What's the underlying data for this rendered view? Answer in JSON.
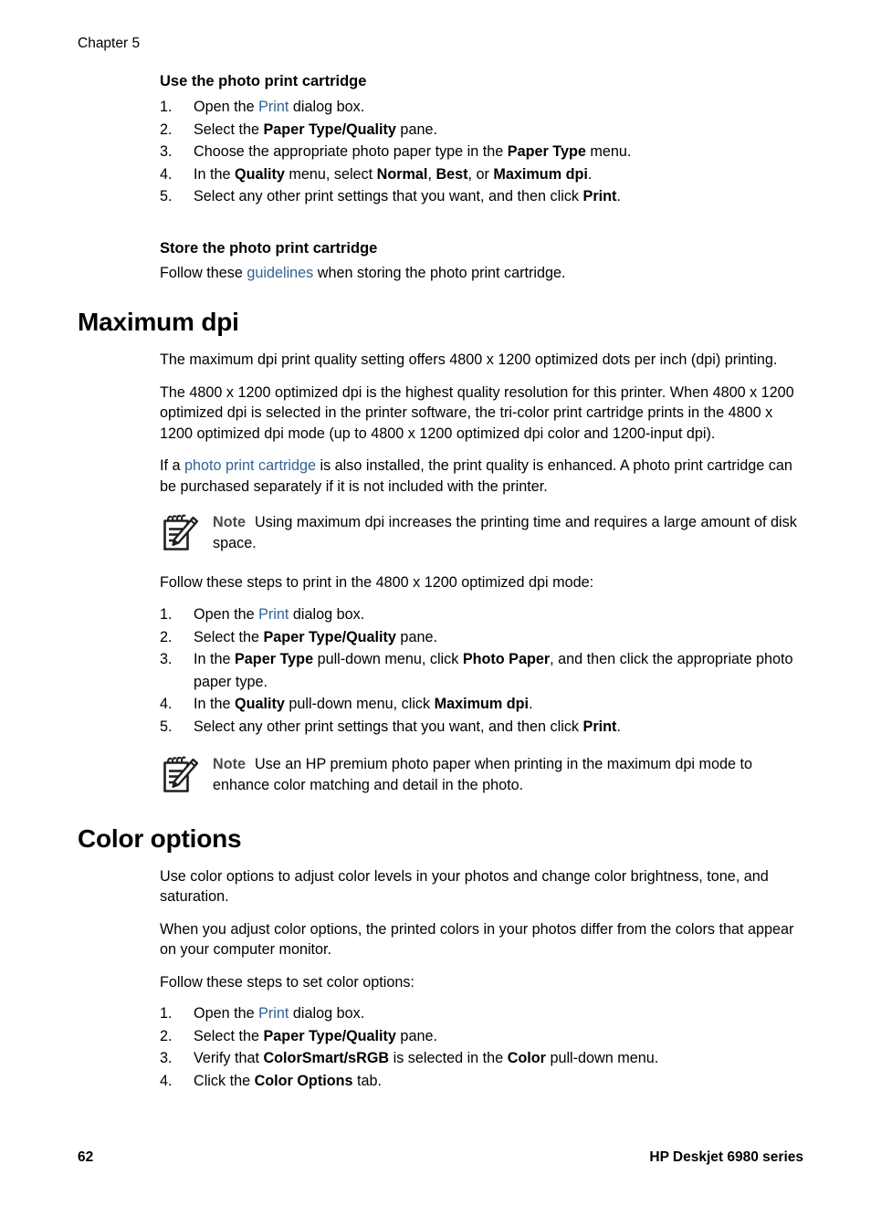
{
  "page": {
    "chapter_header": "Chapter 5",
    "footer_page_number": "62",
    "footer_product": "HP Deskjet 6980 series",
    "link_color": "#2f6196",
    "note_label_color": "#4a4a4a"
  },
  "sections": {
    "use_photo_cartridge": {
      "heading": "Use the photo print cartridge",
      "steps": [
        {
          "num": "1.",
          "parts": [
            {
              "t": "Open the ",
              "style": "normal"
            },
            {
              "t": "Print",
              "style": "link"
            },
            {
              "t": " dialog box.",
              "style": "normal"
            }
          ]
        },
        {
          "num": "2.",
          "parts": [
            {
              "t": "Select the ",
              "style": "normal"
            },
            {
              "t": "Paper Type/Quality",
              "style": "bold"
            },
            {
              "t": " pane.",
              "style": "normal"
            }
          ]
        },
        {
          "num": "3.",
          "parts": [
            {
              "t": "Choose the appropriate photo paper type in the ",
              "style": "normal"
            },
            {
              "t": "Paper Type",
              "style": "bold"
            },
            {
              "t": " menu.",
              "style": "normal"
            }
          ]
        },
        {
          "num": "4.",
          "parts": [
            {
              "t": "In the ",
              "style": "normal"
            },
            {
              "t": "Quality",
              "style": "bold"
            },
            {
              "t": " menu, select ",
              "style": "normal"
            },
            {
              "t": "Normal",
              "style": "bold"
            },
            {
              "t": ", ",
              "style": "normal"
            },
            {
              "t": "Best",
              "style": "bold"
            },
            {
              "t": ", or ",
              "style": "normal"
            },
            {
              "t": "Maximum dpi",
              "style": "bold"
            },
            {
              "t": ".",
              "style": "normal"
            }
          ]
        },
        {
          "num": "5.",
          "parts": [
            {
              "t": "Select any other print settings that you want, and then click ",
              "style": "normal"
            },
            {
              "t": "Print",
              "style": "bold"
            },
            {
              "t": ".",
              "style": "normal"
            }
          ]
        }
      ]
    },
    "store_photo_cartridge": {
      "heading": "Store the photo print cartridge",
      "paragraph": [
        {
          "t": "Follow these ",
          "style": "normal"
        },
        {
          "t": "guidelines",
          "style": "link"
        },
        {
          "t": " when storing the photo print cartridge.",
          "style": "normal"
        }
      ]
    },
    "maximum_dpi": {
      "heading": "Maximum dpi",
      "para1": [
        {
          "t": "The maximum dpi print quality setting offers 4800 x 1200 optimized dots per inch (dpi) printing.",
          "style": "normal"
        }
      ],
      "para2": [
        {
          "t": "The 4800 x 1200 optimized dpi is the highest quality resolution for this printer. When 4800 x 1200 optimized dpi is selected in the printer software, the tri-color print cartridge prints in the 4800 x 1200 optimized dpi mode (up to 4800 x 1200 optimized dpi color and 1200-input dpi).",
          "style": "normal"
        }
      ],
      "para3": [
        {
          "t": "If a ",
          "style": "normal"
        },
        {
          "t": "photo print cartridge",
          "style": "link"
        },
        {
          "t": " is also installed, the print quality is enhanced. A photo print cartridge can be purchased separately if it is not included with the printer.",
          "style": "normal"
        }
      ],
      "note1": {
        "icon": "note-pad-pencil-icon",
        "label": "Note",
        "text": "Using maximum dpi increases the printing time and requires a large amount of disk space."
      },
      "intro": "Follow these steps to print in the 4800 x 1200 optimized dpi mode:",
      "steps": [
        {
          "num": "1.",
          "parts": [
            {
              "t": "Open the ",
              "style": "normal"
            },
            {
              "t": "Print",
              "style": "link"
            },
            {
              "t": " dialog box.",
              "style": "normal"
            }
          ]
        },
        {
          "num": "2.",
          "parts": [
            {
              "t": "Select the ",
              "style": "normal"
            },
            {
              "t": "Paper Type/Quality",
              "style": "bold"
            },
            {
              "t": " pane.",
              "style": "normal"
            }
          ]
        },
        {
          "num": "3.",
          "parts": [
            {
              "t": "In the ",
              "style": "normal"
            },
            {
              "t": "Paper Type",
              "style": "bold"
            },
            {
              "t": " pull-down menu, click ",
              "style": "normal"
            },
            {
              "t": "Photo Paper",
              "style": "bold"
            },
            {
              "t": ", and then click the appropriate photo paper type.",
              "style": "normal"
            }
          ]
        },
        {
          "num": "4.",
          "parts": [
            {
              "t": "In the ",
              "style": "normal"
            },
            {
              "t": "Quality",
              "style": "bold"
            },
            {
              "t": " pull-down menu, click ",
              "style": "normal"
            },
            {
              "t": "Maximum dpi",
              "style": "bold"
            },
            {
              "t": ".",
              "style": "normal"
            }
          ]
        },
        {
          "num": "5.",
          "parts": [
            {
              "t": "Select any other print settings that you want, and then click ",
              "style": "normal"
            },
            {
              "t": "Print",
              "style": "bold"
            },
            {
              "t": ".",
              "style": "normal"
            }
          ]
        }
      ],
      "note2": {
        "icon": "note-pad-pencil-icon",
        "label": "Note",
        "text": "Use an HP premium photo paper when printing in the maximum dpi mode to enhance color matching and detail in the photo."
      }
    },
    "color_options": {
      "heading": "Color options",
      "para1": [
        {
          "t": "Use color options to adjust color levels in your photos and change color brightness, tone, and saturation.",
          "style": "normal"
        }
      ],
      "para2": [
        {
          "t": "When you adjust color options, the printed colors in your photos differ from the colors that appear on your computer monitor.",
          "style": "normal"
        }
      ],
      "intro": "Follow these steps to set color options:",
      "steps": [
        {
          "num": "1.",
          "parts": [
            {
              "t": "Open the ",
              "style": "normal"
            },
            {
              "t": "Print",
              "style": "link"
            },
            {
              "t": " dialog box.",
              "style": "normal"
            }
          ]
        },
        {
          "num": "2.",
          "parts": [
            {
              "t": "Select the ",
              "style": "normal"
            },
            {
              "t": "Paper Type/Quality",
              "style": "bold"
            },
            {
              "t": " pane.",
              "style": "normal"
            }
          ]
        },
        {
          "num": "3.",
          "parts": [
            {
              "t": "Verify that ",
              "style": "normal"
            },
            {
              "t": "ColorSmart/sRGB",
              "style": "bold"
            },
            {
              "t": " is selected in the ",
              "style": "normal"
            },
            {
              "t": "Color",
              "style": "bold"
            },
            {
              "t": " pull-down menu.",
              "style": "normal"
            }
          ]
        },
        {
          "num": "4.",
          "parts": [
            {
              "t": "Click the ",
              "style": "normal"
            },
            {
              "t": "Color Options",
              "style": "bold"
            },
            {
              "t": " tab.",
              "style": "normal"
            }
          ]
        }
      ]
    }
  }
}
